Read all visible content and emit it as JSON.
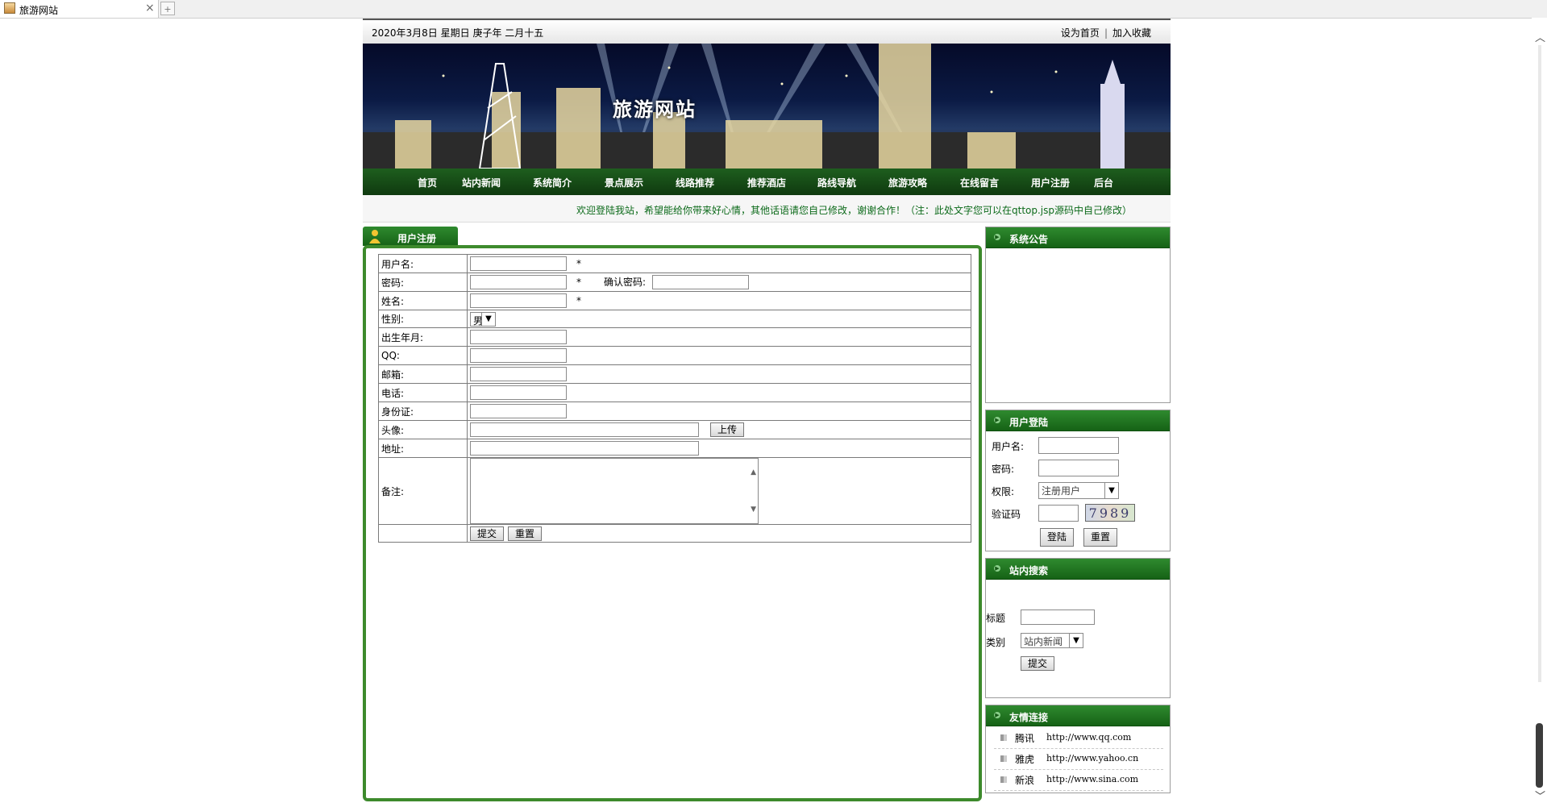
{
  "browser": {
    "tab_title": "旅游网站",
    "close_glyph": "×",
    "newtab_glyph": "+"
  },
  "topbar": {
    "date": "2020年3月8日 星期日 庚子年 二月十五",
    "set_home": "设为首页",
    "separator": "|",
    "add_fav": "加入收藏"
  },
  "banner": {
    "site_title": "旅游网站"
  },
  "nav": [
    "首页",
    "站内新闻",
    "系统简介",
    "景点展示",
    "线路推荐",
    "推荐酒店",
    "路线导航",
    "旅游攻略",
    "在线留言",
    "用户注册",
    "后台"
  ],
  "marquee": "欢迎登陆我站，希望能给你带来好心情，其他话语请您自己修改，谢谢合作！（注：此处文字您可以在qttop.jsp源码中自己修改）",
  "register": {
    "tab_label": "用户注册",
    "required_mark": "*",
    "fields": {
      "username": "用户名:",
      "password": "密码:",
      "confirm_password": "确认密码:",
      "realname": "姓名:",
      "gender": "性别:",
      "gender_value": "男",
      "birth": "出生年月:",
      "qq": "QQ:",
      "email": "邮箱:",
      "phone": "电话:",
      "idcard": "身份证:",
      "avatar": "头像:",
      "upload_button": "上传",
      "address": "地址:",
      "remark": "备注:"
    },
    "submit": "提交",
    "reset": "重置"
  },
  "notice": {
    "title": "系统公告"
  },
  "login": {
    "title": "用户登陆",
    "username": "用户名:",
    "password": "密码:",
    "role": "权限:",
    "role_value": "注册用户",
    "captcha_label": "验证码",
    "captcha_value": "7989",
    "login_button": "登陆",
    "reset_button": "重置"
  },
  "search": {
    "title": "站内搜索",
    "title_label": "标题",
    "category_label": "类别",
    "category_value": "站内新闻",
    "submit": "提交"
  },
  "links": {
    "title": "友情连接",
    "items": [
      {
        "name": "腾讯",
        "url": "http://www.qq.com"
      },
      {
        "name": "雅虎",
        "url": "http://www.yahoo.cn"
      },
      {
        "name": "新浪",
        "url": "http://www.sina.com"
      }
    ]
  },
  "colors": {
    "nav_green": "#0f3a0f",
    "panel_green": "#3d8a2c",
    "marquee_text": "#0c6a1a"
  },
  "icons": [
    "page-icon",
    "close-icon",
    "new-tab-icon",
    "user-icon",
    "arrow-icon",
    "bullet-icon",
    "scroll-up-icon",
    "scroll-down-icon"
  ]
}
